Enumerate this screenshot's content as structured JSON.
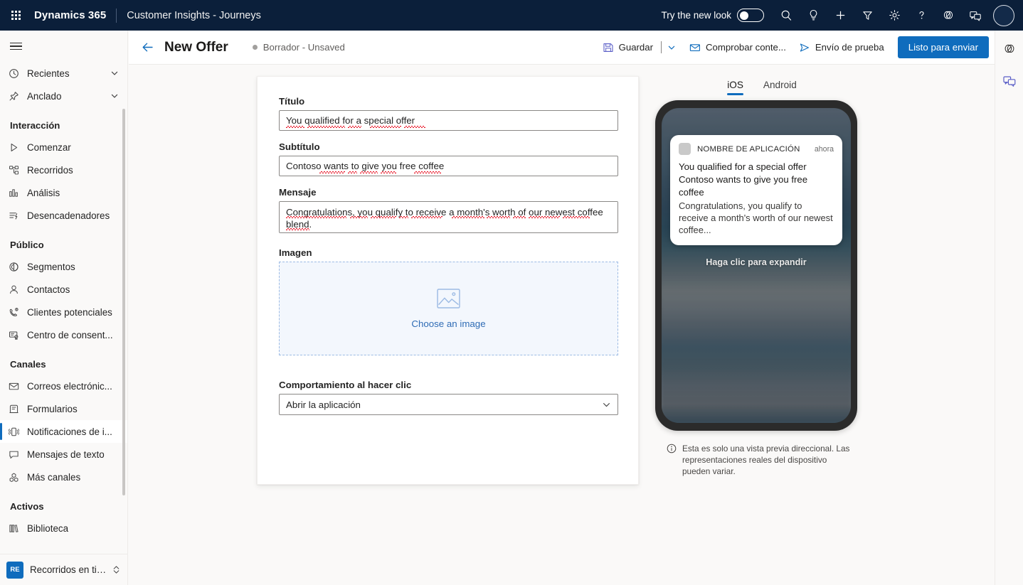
{
  "topbar": {
    "waffle_icon": "app-launcher-grid-icon",
    "brand": "Dynamics 365",
    "app_name": "Customer Insights - Journeys",
    "new_look_label": "Try the new look",
    "new_look_state": "off",
    "icons": [
      {
        "name": "search-icon",
        "title": "Search"
      },
      {
        "name": "lightbulb-icon",
        "title": "Insights"
      },
      {
        "name": "plus-icon",
        "title": "New"
      },
      {
        "name": "filter-icon",
        "title": "Filter"
      },
      {
        "name": "gear-icon",
        "title": "Settings"
      },
      {
        "name": "question-icon",
        "title": "Help"
      },
      {
        "name": "copilot-icon",
        "title": "Copilot"
      },
      {
        "name": "feedback-icon",
        "title": "Feedback"
      }
    ]
  },
  "sidebar": {
    "hamburger_icon": "hamburger-icon",
    "items": [
      {
        "label": "Recientes",
        "icon": "clock-icon",
        "chevron": true,
        "type": "item"
      },
      {
        "label": "Anclado",
        "icon": "pin-icon",
        "chevron": true,
        "type": "item"
      },
      {
        "label": "Interacción",
        "type": "group"
      },
      {
        "label": "Comenzar",
        "icon": "play-icon",
        "type": "item"
      },
      {
        "label": "Recorridos",
        "icon": "journeys-icon",
        "type": "item"
      },
      {
        "label": "Análisis",
        "icon": "analytics-icon",
        "type": "item"
      },
      {
        "label": "Desencadenadores",
        "icon": "trigger-icon",
        "type": "item"
      },
      {
        "label": "Público",
        "type": "group"
      },
      {
        "label": "Segmentos",
        "icon": "segments-icon",
        "type": "item"
      },
      {
        "label": "Contactos",
        "icon": "person-icon",
        "type": "item"
      },
      {
        "label": "Clientes potenciales",
        "icon": "leads-icon",
        "type": "item"
      },
      {
        "label": "Centro de consent...",
        "icon": "consent-icon",
        "type": "item"
      },
      {
        "label": "Canales",
        "type": "group"
      },
      {
        "label": "Correos electrónic...",
        "icon": "mail-icon",
        "type": "item"
      },
      {
        "label": "Formularios",
        "icon": "form-icon",
        "type": "item"
      },
      {
        "label": "Notificaciones de i...",
        "icon": "push-notification-icon",
        "type": "item",
        "active": true
      },
      {
        "label": "Mensajes de texto",
        "icon": "sms-icon",
        "type": "item"
      },
      {
        "label": "Más canales",
        "icon": "more-channels-icon",
        "type": "item"
      },
      {
        "label": "Activos",
        "type": "group"
      },
      {
        "label": "Biblioteca",
        "icon": "library-icon",
        "type": "item"
      }
    ],
    "area_switcher": {
      "badge": "RE",
      "label": "Recorridos en tie...",
      "chevron_icon": "chevron-updown-icon"
    }
  },
  "commandbar": {
    "back_icon": "arrow-left-icon",
    "title": "New Offer",
    "status": "Borrador - Unsaved",
    "save_label": "Guardar",
    "save_icon": "save-icon",
    "save_chevron_icon": "chevron-down-icon",
    "check_content_label": "Comprobar conte...",
    "check_content_icon": "mail-check-icon",
    "test_send_label": "Envío de prueba",
    "test_send_icon": "send-icon",
    "ready_label": "Listo para enviar"
  },
  "form": {
    "title_label": "Título",
    "title_value": "You qualified for a special offer",
    "subtitle_label": "Subtítulo",
    "subtitle_value": "Contoso wants to give you free coffee",
    "message_label": "Mensaje",
    "message_value": "Congratulations, you qualify to receive a month's worth of our newest coffee blend.",
    "image_label": "Imagen",
    "image_placeholder_icon": "image-placeholder-icon",
    "choose_image_label": "Choose an image",
    "click_behavior_label": "Comportamiento al hacer clic",
    "click_behavior_value": "Abrir la aplicación",
    "click_behavior_chevron": "chevron-down-icon"
  },
  "preview": {
    "tabs": [
      {
        "label": "iOS",
        "selected": true
      },
      {
        "label": "Android",
        "selected": false
      }
    ],
    "notification": {
      "app_icon": "app-icon-placeholder",
      "app_name": "NOMBRE DE APLICACIÓN",
      "time": "ahora",
      "title": "You qualified for a special offer",
      "subtitle": "Contoso wants to give you free coffee",
      "body": "Congratulations, you qualify to receive a month's worth of our newest coffee..."
    },
    "expand_hint": "Haga clic para expandir",
    "disclaimer_icon": "info-icon",
    "disclaimer": "Esta es solo una vista previa direccional. Las representaciones reales del dispositivo pueden variar."
  },
  "colors": {
    "topbar_bg": "#0b1f3a",
    "accent": "#0f6cbd",
    "canvas_bg": "#faf9f8",
    "dropzone_bg": "#f3f7fd",
    "dropzone_border": "#9dbbe4",
    "spellcheck": "#e81123"
  }
}
